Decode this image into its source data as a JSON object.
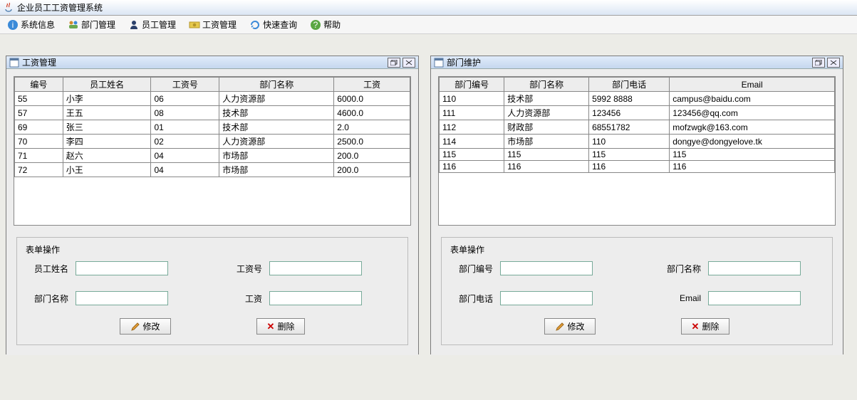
{
  "app_title": "企业员工工资管理系统",
  "menu": {
    "sysinfo": "系统信息",
    "dept": "部门管理",
    "emp": "员工管理",
    "salary": "工资管理",
    "query": "快速查询",
    "help": "帮助"
  },
  "win_salary": {
    "title": "工资管理",
    "headers": [
      "编号",
      "员工姓名",
      "工资号",
      "部门名称",
      "工资"
    ],
    "rows": [
      [
        "55",
        "小李",
        "06",
        "人力资源部",
        "6000.0"
      ],
      [
        "57",
        "王五",
        "08",
        "技术部",
        "4600.0"
      ],
      [
        "69",
        "张三",
        "01",
        "技术部",
        "2.0"
      ],
      [
        "70",
        "李四",
        "02",
        "人力资源部",
        "2500.0"
      ],
      [
        "71",
        "赵六",
        "04",
        "市场部",
        "200.0"
      ],
      [
        "72",
        "小王",
        "04",
        "市场部",
        "200.0"
      ]
    ],
    "form_title": "表单操作",
    "labels": {
      "name": "员工姓名",
      "salid": "工资号",
      "dept": "部门名称",
      "salary": "工资"
    },
    "btn_edit": "修改",
    "btn_del": "删除"
  },
  "win_dept": {
    "title": "部门维护",
    "headers": [
      "部门编号",
      "部门名称",
      "部门电话",
      "Email"
    ],
    "rows": [
      [
        "110",
        "技术部",
        "5992 8888",
        "campus@baidu.com"
      ],
      [
        "111",
        "人力资源部",
        "123456",
        "123456@qq.com"
      ],
      [
        "112",
        "财政部",
        "68551782",
        "mofzwgk@163.com"
      ],
      [
        "114",
        "市场部",
        "110",
        "dongye@dongyelove.tk"
      ],
      [
        "115",
        "115",
        "115",
        "115"
      ],
      [
        "116",
        "116",
        "116",
        "116"
      ]
    ],
    "form_title": "表单操作",
    "labels": {
      "id": "部门编号",
      "name": "部门名称",
      "phone": "部门电话",
      "email": "Email"
    },
    "btn_edit": "修改",
    "btn_del": "删除"
  }
}
